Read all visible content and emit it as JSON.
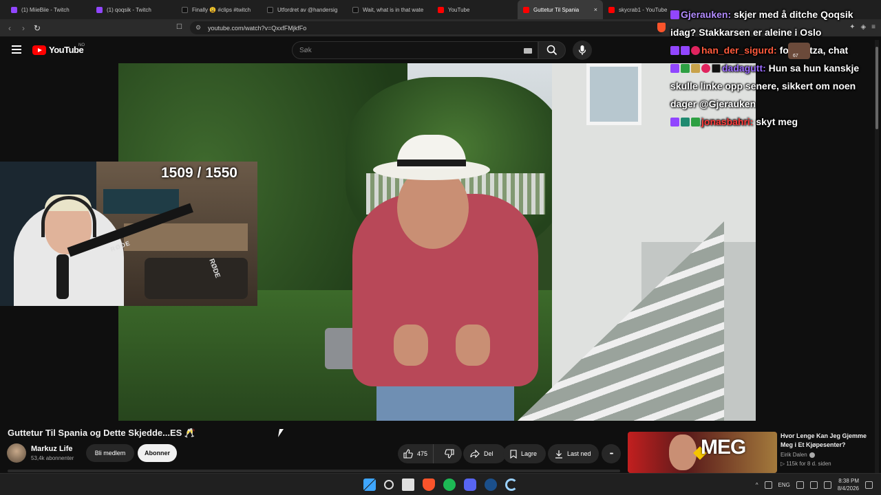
{
  "browser": {
    "tabs": [
      {
        "label": "(1) MiieBiie - Twitch",
        "icon": "twitch-icon",
        "active": false
      },
      {
        "label": "(1) qoqsik - Twitch",
        "icon": "twitch-icon",
        "active": false
      },
      {
        "label": "Finally 😩 #clips #twitch",
        "icon": "tiktok-icon",
        "active": false
      },
      {
        "label": "Utfordret av @handersig",
        "icon": "tiktok-icon",
        "active": false
      },
      {
        "label": "Wait, what is in that wate",
        "icon": "tiktok-icon",
        "active": false
      },
      {
        "label": "YouTube",
        "icon": "youtube-icon",
        "active": false
      },
      {
        "label": "Guttetur Til Spania",
        "icon": "youtube-icon",
        "active": true
      },
      {
        "label": "skycrab1 - YouTube",
        "icon": "youtube-icon",
        "active": false
      }
    ],
    "close_glyph": "×",
    "url": "youtube.com/watch?v=QxxfFMjkfFo"
  },
  "youtube": {
    "logo_text": "YouTube",
    "country_code": "NO",
    "search_placeholder": "Søk"
  },
  "overlay": {
    "counter": "1509 / 1550",
    "webcam_brand": "RØDE",
    "chat": [
      {
        "badges": [
          "purple"
        ],
        "user": "Gjerauken:",
        "user_class": "u1",
        "message": " skjer med å ditche Qoqsik idag? Stakkarsen er aleine i Oslo"
      },
      {
        "badges": [
          "purple",
          "purple",
          "heart"
        ],
        "user": "han_der_sigurd:",
        "user_class": "u2",
        "message": " for mutza, chat"
      },
      {
        "badges": [
          "purple",
          "green",
          "gold",
          "heart",
          "black"
        ],
        "user": "dadagutt:",
        "user_class": "u3",
        "message": " Hun sa hun kanskje skulle linke opp senere, sikkert om noen dager @Gjerauken"
      },
      {
        "badges": [
          "purple",
          "teal",
          "green"
        ],
        "user": "jonasbahri:",
        "user_class": "u4",
        "message": " skyt meg"
      }
    ],
    "avatar_count": "67"
  },
  "video": {
    "title": "Guttetur Til Spania og Dette Skjedde...ES 🥂",
    "channel_name": "Markuz Life",
    "channel_subs": "53,4k abonnenter",
    "member_label": "Bli medlem",
    "subscribe_label": "Abonner",
    "like_count": "475",
    "share_label": "Del",
    "save_label": "Lagre",
    "download_label": "Last ned",
    "more_glyph": "•••"
  },
  "recommendation": {
    "thumb_text": "MEG",
    "title": "Hvor Lenge Kan Jeg Gjemme Meg i Et Kjøpesenter?",
    "channel": "Eirik Dalen",
    "meta": "▷ 115k   for 8 d. siden"
  },
  "taskbar": {
    "lang": "ENG",
    "time": "8:38 PM",
    "date": "8/4/2026",
    "chevron": "^"
  },
  "colors": {
    "youtube_red": "#ff0000",
    "twitch_purple": "#9146ff",
    "background": "#0f0f0f"
  }
}
